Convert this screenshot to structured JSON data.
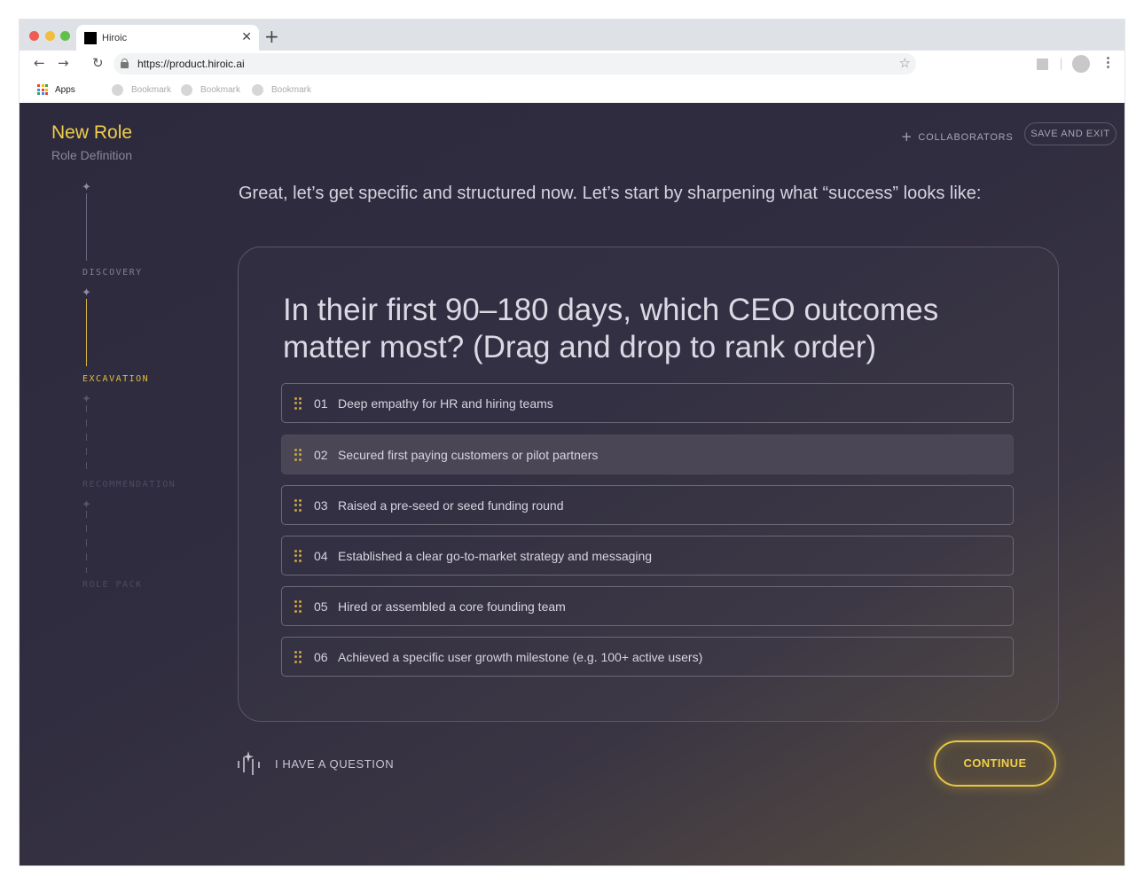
{
  "browser": {
    "tab_title": "Hiroic",
    "url": "https://product.hiroic.ai",
    "bookmarks_bar": {
      "apps_label": "Apps",
      "bookmarks": [
        "Bookmark",
        "Bookmark",
        "Bookmark"
      ]
    }
  },
  "header": {
    "title": "New Role",
    "subtitle": "Role Definition",
    "collaborators_label": "COLLABORATORS",
    "save_exit_label": "SAVE AND EXIT"
  },
  "stepper": {
    "steps": [
      {
        "label": "DISCOVERY",
        "state": "complete"
      },
      {
        "label": "EXCAVATION",
        "state": "active"
      },
      {
        "label": "RECOMMENDATION",
        "state": "upcoming"
      },
      {
        "label": "ROLE PACK",
        "state": "upcoming"
      }
    ]
  },
  "main": {
    "intro": "Great, let’s get specific and structured now. Let’s start by sharpening what “success” looks like:",
    "question": "In their first 90–180 days, which CEO outcomes matter most? (Drag and drop to rank order)",
    "ranking": [
      {
        "num": "01",
        "text": "Deep empathy for HR and hiring teams"
      },
      {
        "num": "02",
        "text": "Secured first paying customers or pilot partners"
      },
      {
        "num": "03",
        "text": "Raised a pre-seed or seed funding round"
      },
      {
        "num": "04",
        "text": "Established a clear go-to-market strategy and messaging"
      },
      {
        "num": "05",
        "text": "Hired or assembled a core founding team"
      },
      {
        "num": "06",
        "text": "Achieved a specific user growth milestone (e.g. 100+ active users)"
      }
    ],
    "hovered_item": 2
  },
  "footer": {
    "question_label": "I HAVE A QUESTION",
    "continue_label": "CONTINUE"
  },
  "colors": {
    "accent": "#f1cf4a",
    "background": "#2c2a3c",
    "text": "#d7d4e0"
  }
}
